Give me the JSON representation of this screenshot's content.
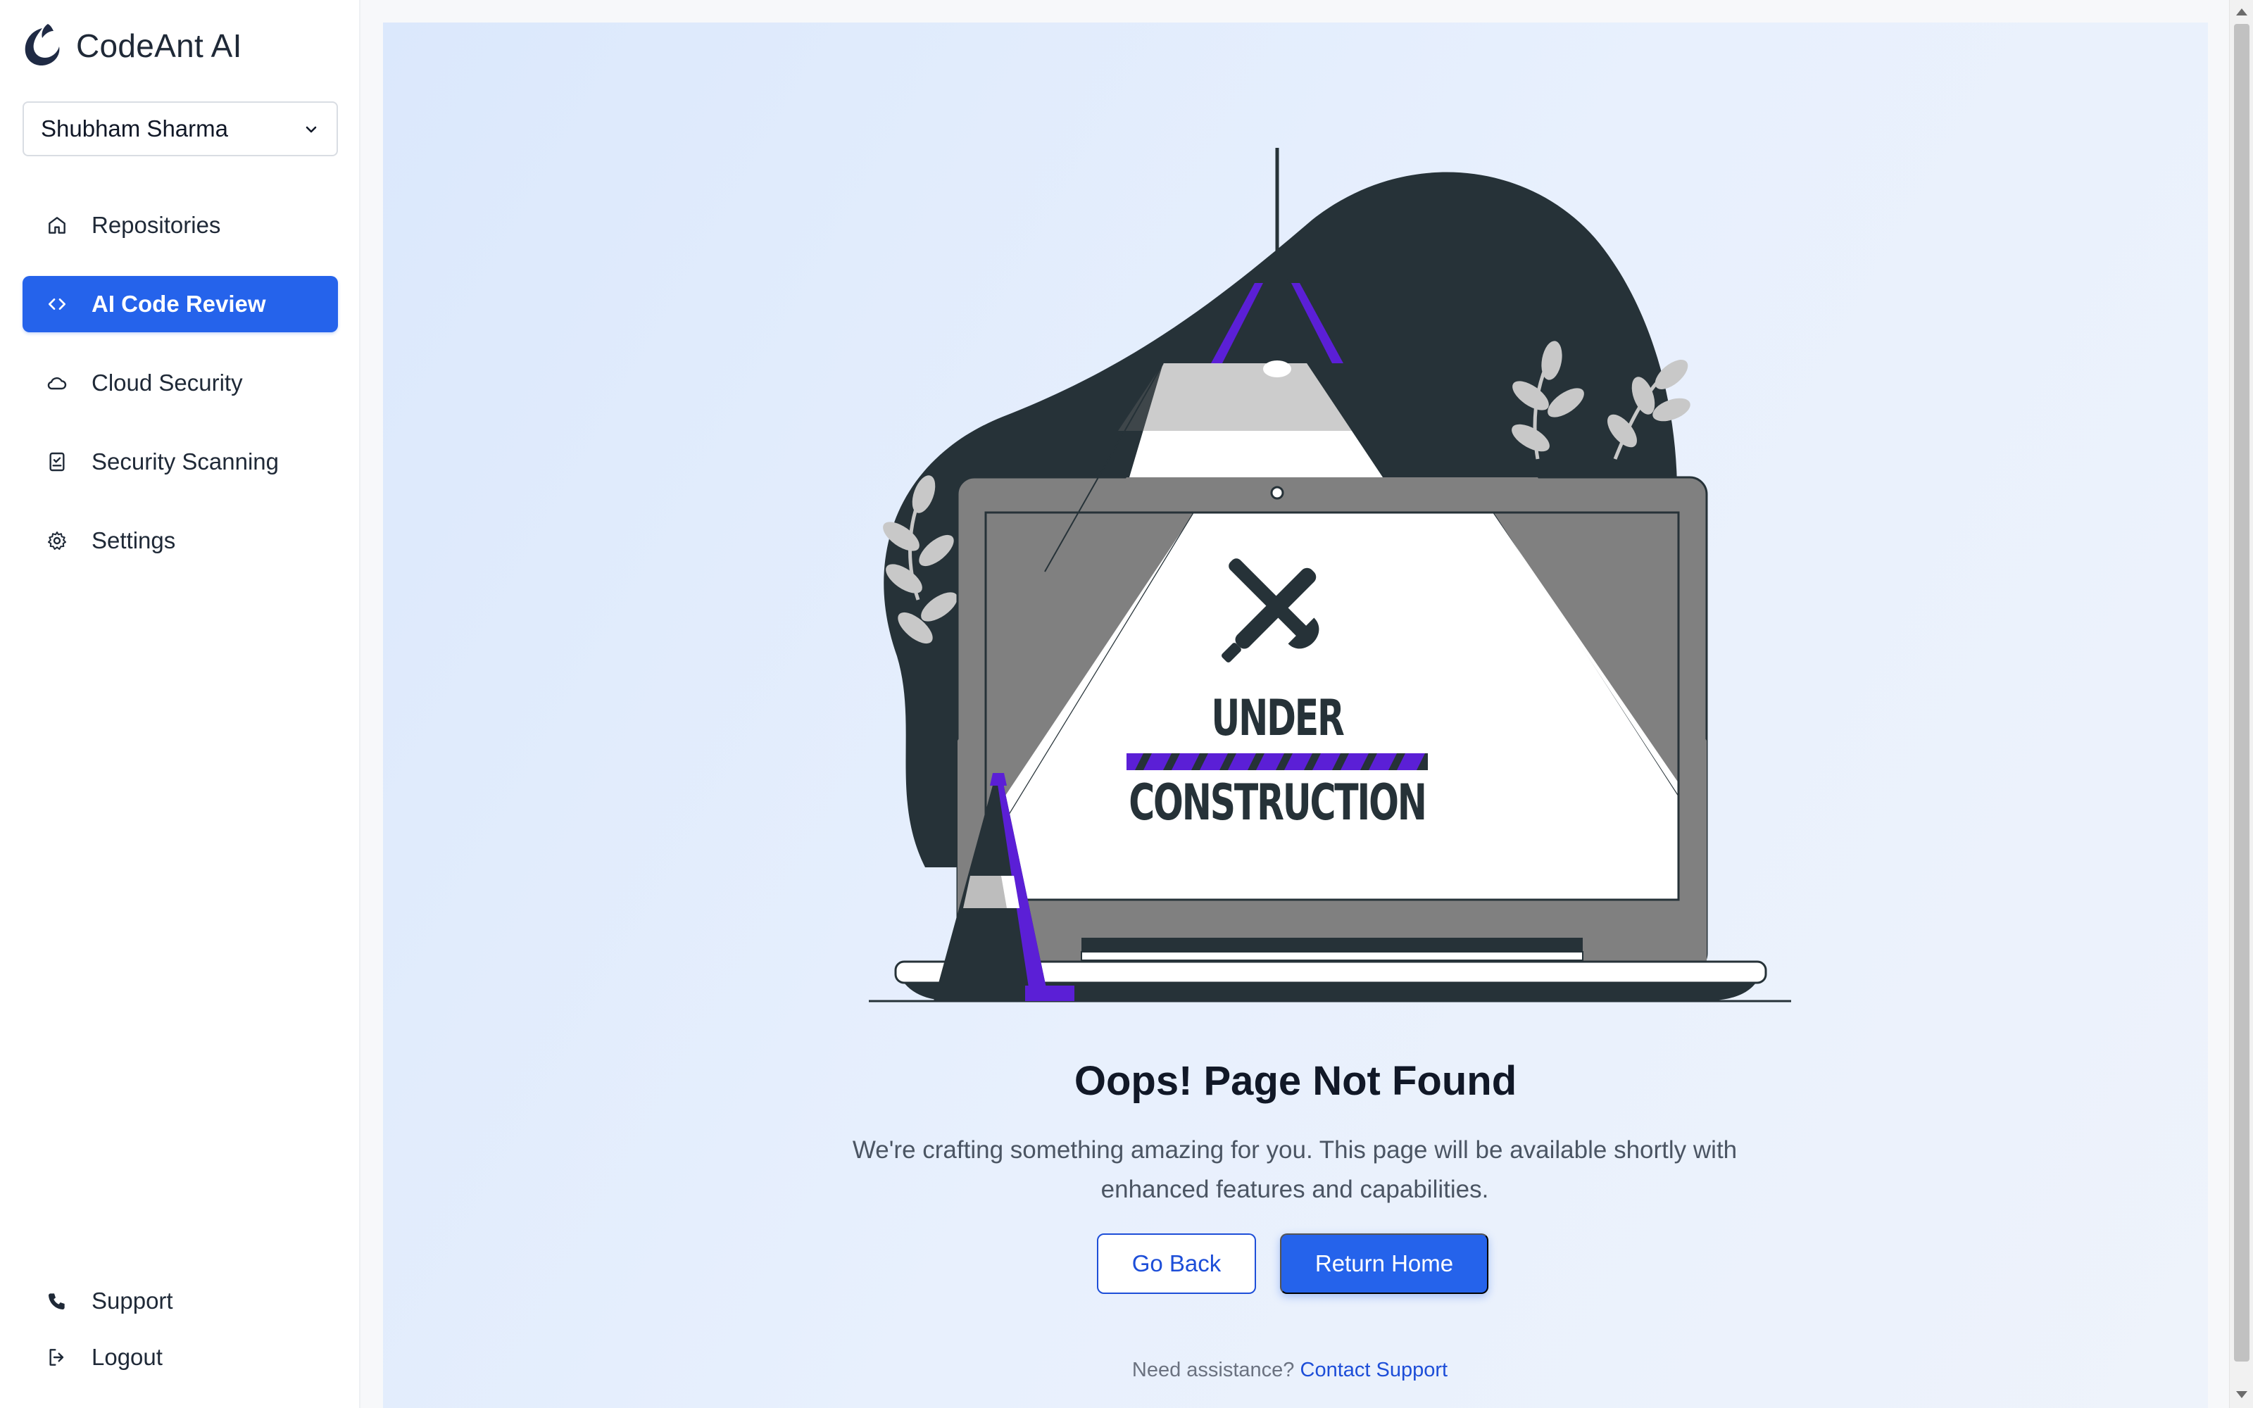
{
  "brand": {
    "name": "CodeAnt AI",
    "logo_icon": "codeant-logo-icon"
  },
  "org_selector": {
    "value": "Shubham Sharma"
  },
  "sidebar": {
    "items": [
      {
        "label": "Repositories",
        "icon": "home-icon",
        "active": false
      },
      {
        "label": "AI Code Review",
        "icon": "code-icon",
        "active": true
      },
      {
        "label": "Cloud Security",
        "icon": "cloud-icon",
        "active": false
      },
      {
        "label": "Security Scanning",
        "icon": "scan-icon",
        "active": false
      },
      {
        "label": "Settings",
        "icon": "gear-icon",
        "active": false
      }
    ],
    "bottom_items": [
      {
        "label": "Support",
        "icon": "phone-icon"
      },
      {
        "label": "Logout",
        "icon": "logout-icon"
      }
    ]
  },
  "illustration": {
    "line1": "UNDER",
    "line2": "CONSTRUCTION"
  },
  "main": {
    "title": "Oops! Page Not Found",
    "description": "We're crafting something amazing for you. This page will be available shortly with enhanced features and capabilities.",
    "back_button": "Go Back",
    "home_button": "Return Home",
    "help_text": "Need assistance?",
    "help_link": "Contact Support"
  },
  "colors": {
    "accent": "#2563eb",
    "illustration_dark": "#263238",
    "illustration_purple": "#5b1fd6"
  }
}
